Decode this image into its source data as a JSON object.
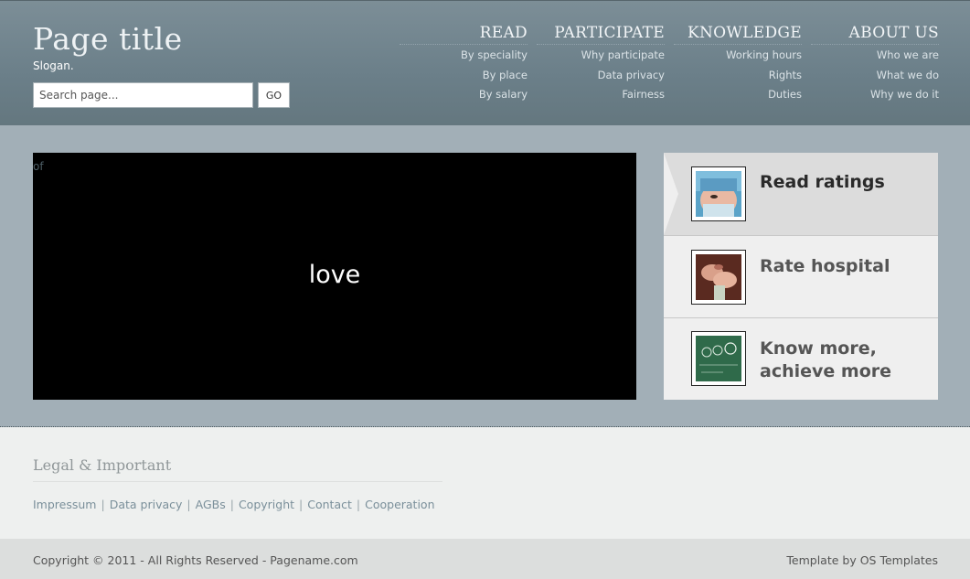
{
  "header": {
    "title": "Page title",
    "slogan": "Slogan.",
    "search_placeholder": "Search page...",
    "go_label": "GO"
  },
  "nav": [
    {
      "label": "READ",
      "items": [
        "By speciality",
        "By place",
        "By salary"
      ]
    },
    {
      "label": "PARTICIPATE",
      "items": [
        "Why participate",
        "Data privacy",
        "Fairness"
      ]
    },
    {
      "label": "KNOWLEDGE",
      "items": [
        "Working hours",
        "Rights",
        "Duties"
      ]
    },
    {
      "label": "ABOUT US",
      "items": [
        "Who we are",
        "What we do",
        "Why we do it"
      ]
    }
  ],
  "slider": {
    "counter": "of",
    "caption": "love"
  },
  "tabs": [
    {
      "label": "Read ratings",
      "icon": "surgeon-photo"
    },
    {
      "label": "Rate hospital",
      "icon": "hands-photo"
    },
    {
      "label": "Know more, achieve more",
      "icon": "chalkboard-photo"
    }
  ],
  "footer": {
    "heading": "Legal & Important",
    "links": [
      "Impressum",
      "Data privacy",
      "AGBs",
      "Copyright",
      "Contact",
      "Cooperation"
    ],
    "copyright": "Copyright © 2011 - All Rights Reserved - Pagename.com",
    "credit": "Template by OS Templates"
  },
  "colors": {
    "header_bg": "#6b7f89",
    "main_bg": "#a2afb7",
    "slider_bg": "#000000",
    "tab_bg": "#efefef",
    "tab_active_bg": "#dcdcdc",
    "footer_bg": "#eef0ef",
    "copyright_bg": "#dcdedd",
    "link_color": "#7a8f9a"
  }
}
